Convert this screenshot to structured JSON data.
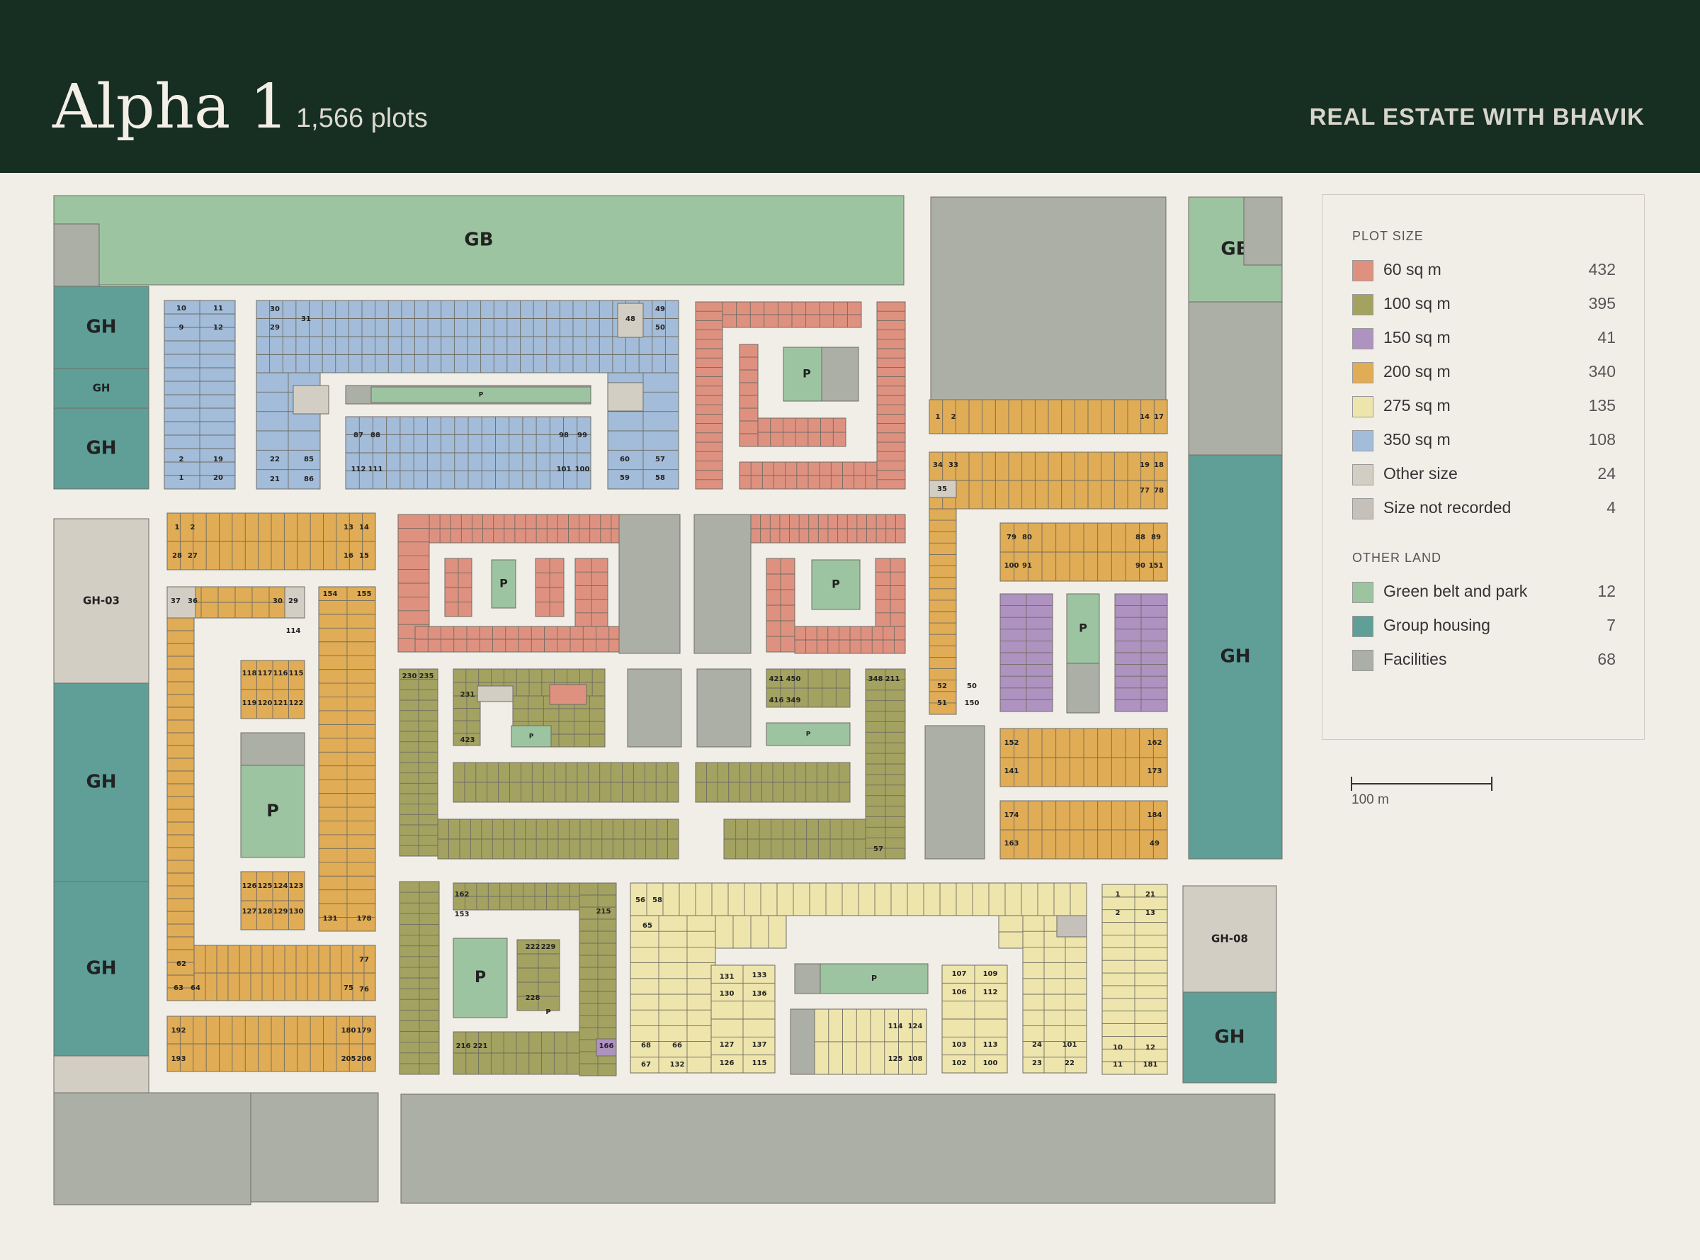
{
  "header": {
    "title": "Alpha 1",
    "subtitle": "1,566 plots",
    "brand": "REAL ESTATE WITH BHAVIK"
  },
  "legend": {
    "plot_size_heading": "PLOT SIZE",
    "plot_sizes": [
      {
        "label": "60 sq m",
        "count": "432",
        "color": "#df9180"
      },
      {
        "label": "100 sq m",
        "count": "395",
        "color": "#a3a260"
      },
      {
        "label": "150 sq m",
        "count": "41",
        "color": "#ae92c0"
      },
      {
        "label": "200 sq m",
        "count": "340",
        "color": "#e0ac55"
      },
      {
        "label": "275 sq m",
        "count": "135",
        "color": "#eee5ad"
      },
      {
        "label": "350 sq m",
        "count": "108",
        "color": "#a2bcd9"
      },
      {
        "label": "Other size",
        "count": "24",
        "color": "#d3cec4"
      },
      {
        "label": "Size not recorded",
        "count": "4",
        "color": "#c5c1ba"
      }
    ],
    "other_land_heading": "OTHER LAND",
    "other_land": [
      {
        "label": "Green belt and park",
        "count": "12",
        "color": "#9dc4a0"
      },
      {
        "label": "Group housing",
        "count": "7",
        "color": "#5f9f98"
      },
      {
        "label": "Facilities",
        "count": "68",
        "color": "#abafa6"
      }
    ]
  },
  "scale_bar": {
    "label": "100 m"
  },
  "map": {
    "green_belts": [
      "GB",
      "GB"
    ],
    "group_housing": [
      "GH",
      "GH",
      "GH",
      "GH-03",
      "GH",
      "GH",
      "GH",
      "GH-08",
      "GH"
    ],
    "parks": [
      "P",
      "P",
      "P",
      "P",
      "P",
      "P",
      "P",
      "P",
      "P",
      "P",
      "P"
    ],
    "plot_numbers": [
      "10",
      "11",
      "9",
      "12",
      "2",
      "19",
      "1",
      "20",
      "30",
      "31",
      "29",
      "22",
      "85",
      "21",
      "86",
      "87",
      "88",
      "112",
      "111",
      "98",
      "99",
      "101",
      "100",
      "48",
      "49",
      "50",
      "60",
      "57",
      "59",
      "58",
      "1",
      "2",
      "28",
      "27",
      "13",
      "14",
      "16",
      "15",
      "37",
      "36",
      "30",
      "29",
      "114",
      "154",
      "155",
      "118",
      "117",
      "116",
      "115",
      "119",
      "120",
      "121",
      "122",
      "126",
      "125",
      "124",
      "123",
      "127",
      "128",
      "129",
      "130",
      "131",
      "178",
      "62",
      "63",
      "64",
      "75",
      "76",
      "77",
      "192",
      "193",
      "205",
      "206",
      "179",
      "180",
      "1",
      "2",
      "14",
      "17",
      "34",
      "33",
      "35",
      "19",
      "18",
      "77",
      "78",
      "79",
      "80",
      "88",
      "89",
      "100",
      "91",
      "90",
      "151",
      "152",
      "141",
      "162",
      "173",
      "174",
      "163",
      "184",
      "49",
      "52",
      "50",
      "51",
      "150",
      "230",
      "235",
      "231",
      "423",
      "421",
      "450",
      "416",
      "349",
      "348",
      "211",
      "57",
      "56",
      "58",
      "65",
      "68",
      "66",
      "67",
      "132",
      "131",
      "133",
      "130",
      "136",
      "127",
      "137",
      "126",
      "115",
      "114",
      "124",
      "125",
      "108",
      "107",
      "109",
      "106",
      "112",
      "103",
      "113",
      "102",
      "100",
      "24",
      "101",
      "23",
      "22",
      "1",
      "21",
      "2",
      "13",
      "10",
      "12",
      "11",
      "181",
      "162",
      "153",
      "166",
      "215",
      "216",
      "221",
      "222",
      "229",
      "228",
      "P"
    ]
  }
}
